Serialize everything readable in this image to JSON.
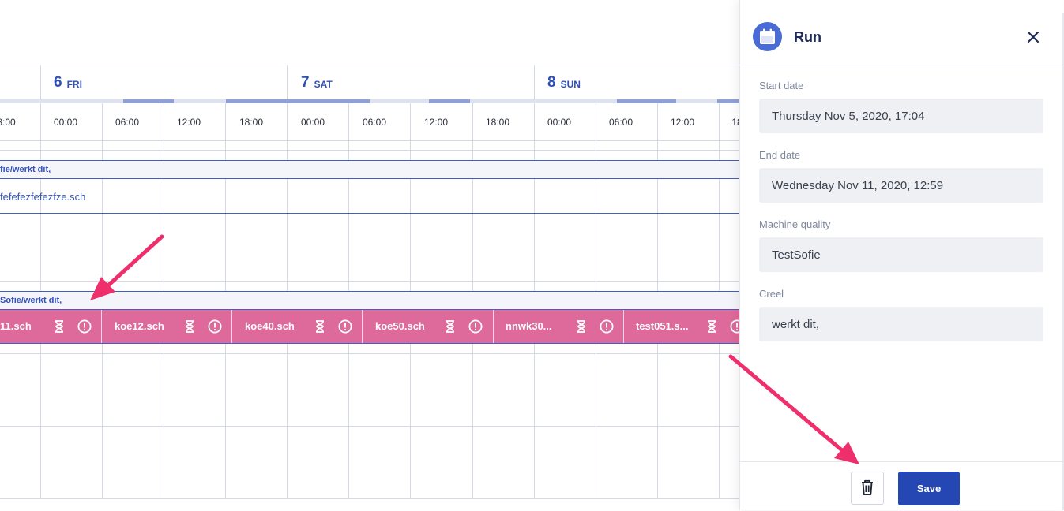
{
  "schedule": {
    "days": [
      {
        "num": "6",
        "name": "FRI"
      },
      {
        "num": "7",
        "name": "SAT"
      },
      {
        "num": "8",
        "name": "SUN"
      }
    ],
    "times": [
      "8:00",
      "00:00",
      "06:00",
      "12:00",
      "18:00",
      "00:00",
      "06:00",
      "12:00",
      "18:00",
      "00:00",
      "06:00",
      "12:00",
      "18"
    ],
    "lane1": {
      "band_label": "fie/werkt dit,",
      "file": "fefefezfefezfze.sch"
    },
    "lane2": {
      "band_label": "Sofie/werkt dit,"
    },
    "jobs": [
      {
        "name": "11.sch"
      },
      {
        "name": "koe12.sch"
      },
      {
        "name": "koe40.sch"
      },
      {
        "name": "koe50.sch"
      },
      {
        "name": "nnwk30..."
      },
      {
        "name": "test051.s..."
      }
    ],
    "job_color": "#dd6a9b",
    "accent": "#2f50b5"
  },
  "panel": {
    "title": "Run",
    "icon": "calendar-icon",
    "fields": [
      {
        "label": "Start date",
        "value": "Thursday Nov 5, 2020, 17:04"
      },
      {
        "label": "End date",
        "value": "Wednesday Nov 11, 2020, 12:59"
      },
      {
        "label": "Machine quality",
        "value": "TestSofie"
      },
      {
        "label": "Creel",
        "value": "werkt dit,"
      }
    ],
    "save_label": "Save",
    "delete_icon": "trash-icon",
    "close_icon": "close-icon",
    "button_color": "#2447b3"
  },
  "annotation": {
    "arrow_color": "#ee2f6c"
  }
}
